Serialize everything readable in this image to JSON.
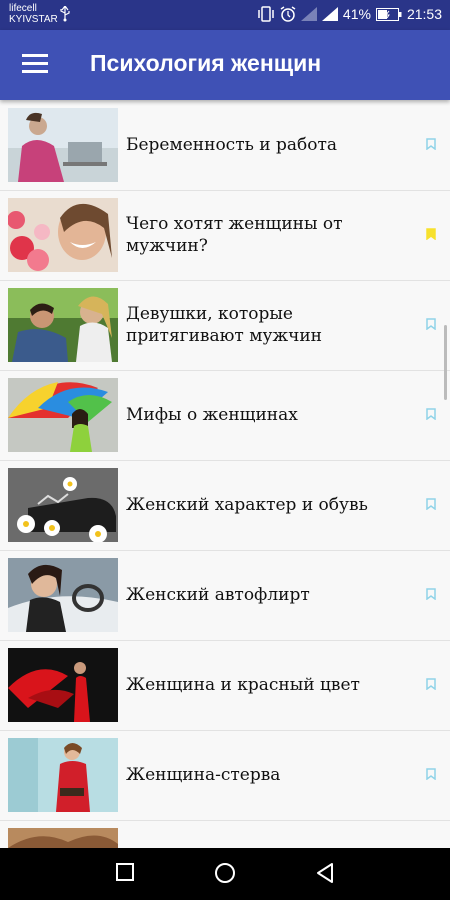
{
  "status_bar": {
    "carrier_line1": "lifecell",
    "carrier_line2": "KYIVSTAR",
    "battery": "41%",
    "time": "21:53"
  },
  "app_bar": {
    "title": "Психология женщин"
  },
  "articles": [
    {
      "title": "Беременность и работа",
      "bookmarked": false
    },
    {
      "title": "Чего хотят женщины от мужчин?",
      "bookmarked": true
    },
    {
      "title": "Девушки, которые притягивают мужчин",
      "bookmarked": false
    },
    {
      "title": "Мифы о женщинах",
      "bookmarked": false
    },
    {
      "title": "Женский характер и обувь",
      "bookmarked": false
    },
    {
      "title": "Женский автофлирт",
      "bookmarked": false
    },
    {
      "title": "Женщина и красный цвет",
      "bookmarked": false
    },
    {
      "title": "Женщина-стерва",
      "bookmarked": false
    }
  ],
  "colors": {
    "app_bar": "#3f51b5",
    "status_bar": "#2a3589",
    "bookmark_empty": "#8fd3e8",
    "bookmark_filled": "#f7e12d"
  },
  "icons": {
    "menu": "menu-icon",
    "bookmark": "bookmark-icon",
    "nav_recent": "recent-apps-icon",
    "nav_home": "home-icon",
    "nav_back": "back-icon"
  }
}
